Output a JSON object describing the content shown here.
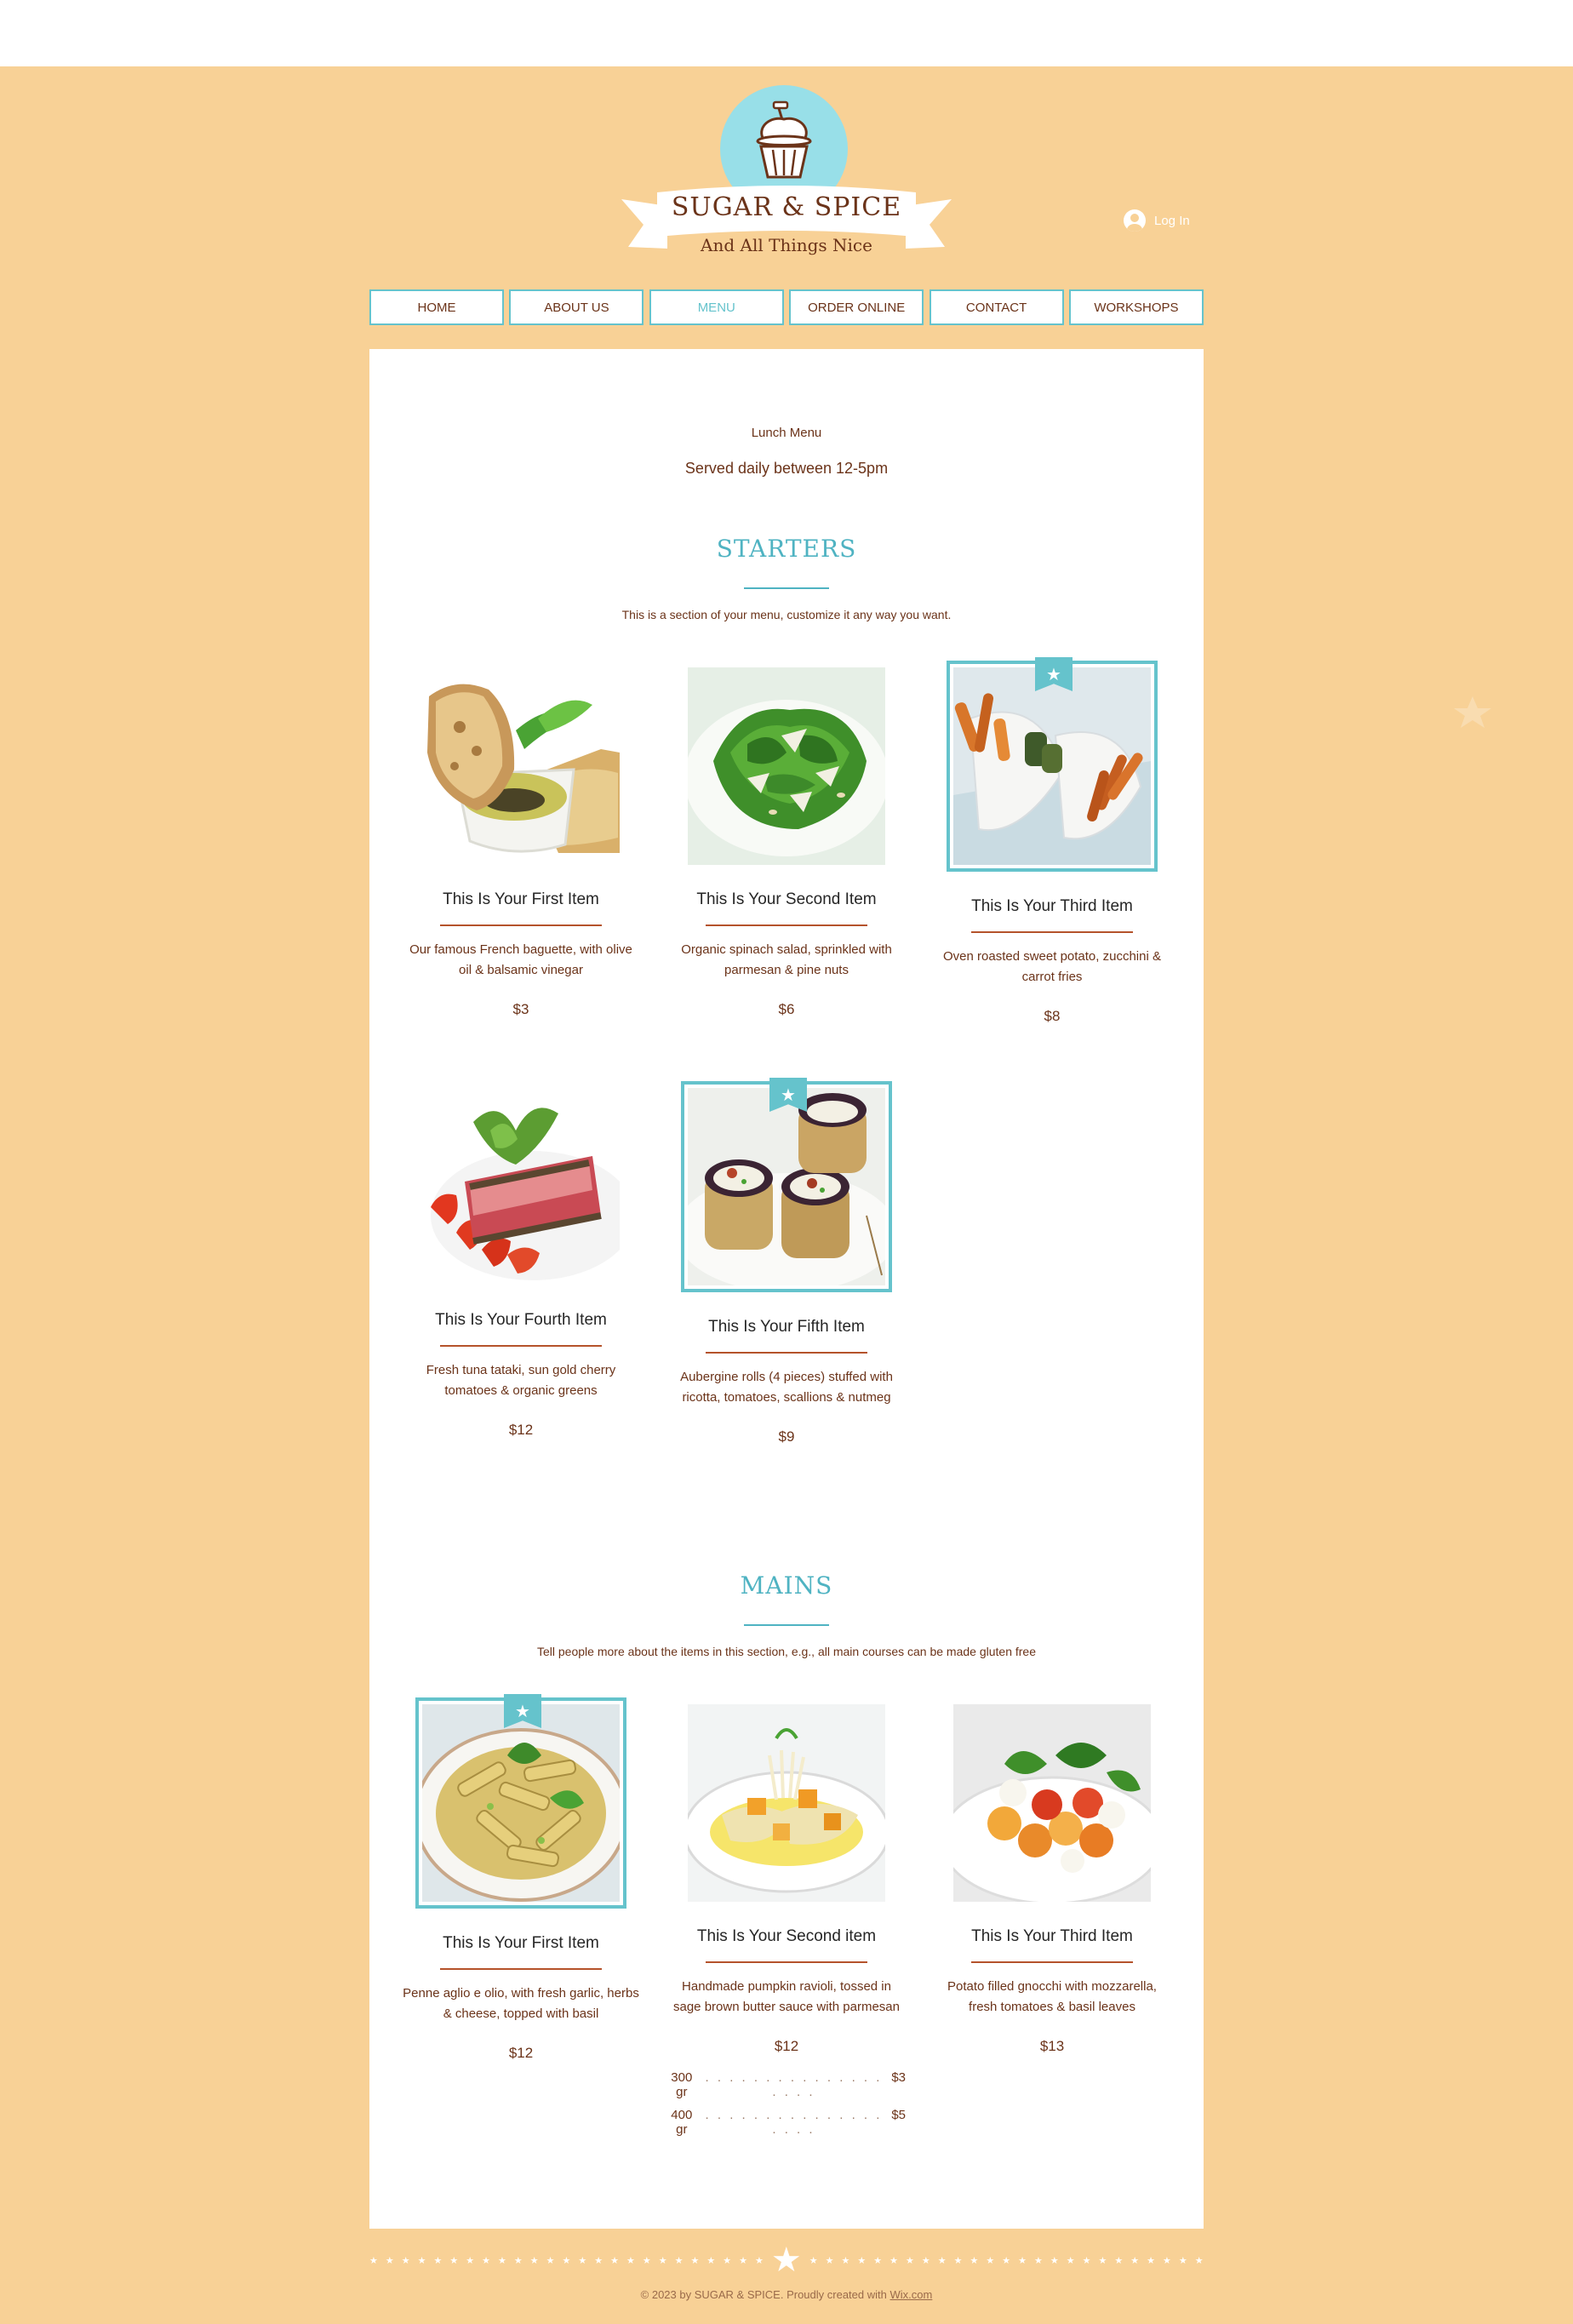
{
  "colors": {
    "background": "#f8d196",
    "accent": "#65c3cc",
    "title": "#4fb3c2",
    "brown": "#6b3319",
    "rule": "#b5532b",
    "logo_circle": "#98dfe8"
  },
  "header": {
    "brand": "SUGAR & SPICE",
    "tagline": "And All Things Nice",
    "logo_icon": "cupcake-icon",
    "login_label": "Log In"
  },
  "nav": {
    "items": [
      {
        "label": "HOME"
      },
      {
        "label": "ABOUT US"
      },
      {
        "label": "MENU",
        "active": true
      },
      {
        "label": "ORDER ONLINE"
      },
      {
        "label": "CONTACT"
      },
      {
        "label": "WORKSHOPS"
      }
    ]
  },
  "menu": {
    "label": "Lunch Menu",
    "served": "Served daily between 12-5pm"
  },
  "sections": [
    {
      "title": "STARTERS",
      "description": "This is a section of your menu, customize it any way you want.",
      "items": [
        {
          "name": "This Is Your First Item",
          "description": "Our famous French baguette, with olive oil & balsamic vinegar",
          "price": "$3",
          "special": false,
          "photo": "bread-olive-oil-photo"
        },
        {
          "name": "This Is Your Second Item",
          "description": "Organic spinach salad, sprinkled with parmesan & pine nuts",
          "price": "$6",
          "special": false,
          "photo": "spinach-salad-photo"
        },
        {
          "name": "This Is Your Third Item",
          "description": "Oven roasted sweet potato, zucchini & carrot fries",
          "price": "$8",
          "special": true,
          "photo": "veggie-fries-photo"
        },
        {
          "name": "This Is Your Fourth Item",
          "description": "Fresh tuna tataki, sun gold cherry tomatoes & organic greens",
          "price": "$12",
          "special": false,
          "photo": "tuna-tataki-photo"
        },
        {
          "name": "This Is Your Fifth Item",
          "description": "Aubergine rolls (4 pieces) stuffed with ricotta, tomatoes, scallions & nutmeg",
          "price": "$9",
          "special": true,
          "photo": "aubergine-rolls-photo"
        }
      ]
    },
    {
      "title": "MAINS",
      "description": "Tell people more about the items in this section, e.g., all main courses can be made gluten free",
      "items": [
        {
          "name": "This Is Your First Item",
          "description": "Penne aglio e olio, with fresh garlic, herbs & cheese, topped with basil",
          "price": "$12",
          "special": true,
          "photo": "penne-pasta-photo"
        },
        {
          "name": "This Is Your Second item",
          "description": "Handmade pumpkin ravioli, tossed in sage brown butter sauce with parmesan",
          "price": "$12",
          "special": false,
          "photo": "pumpkin-ravioli-photo",
          "sizes": [
            {
              "label": "300 gr",
              "dots": ". . . . . . . . . . . . . . . . . . .",
              "price": "$3"
            },
            {
              "label": "400 gr",
              "dots": ". . . . . . . . . . . . . . . . . . .",
              "price": "$5"
            }
          ]
        },
        {
          "name": "This Is Your Third Item",
          "description": "Potato filled gnocchi with mozzarella, fresh tomatoes & basil leaves",
          "price": "$13",
          "special": false,
          "photo": "gnocchi-photo"
        }
      ]
    }
  ],
  "footer": {
    "copyright": "© 2023 by SUGAR & SPICE. Proudly created with",
    "link": "Wix.com"
  }
}
